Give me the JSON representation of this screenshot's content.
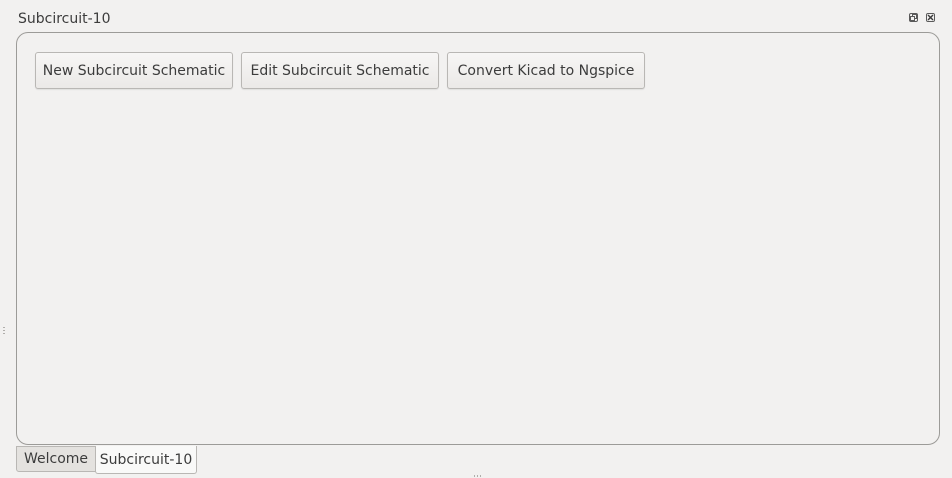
{
  "dock": {
    "title": "Subcircuit-10"
  },
  "toolbar": {
    "new_label": "New Subcircuit Schematic",
    "edit_label": "Edit Subcircuit Schematic",
    "convert_label": "Convert Kicad to Ngspice"
  },
  "tabs": [
    {
      "label": "Welcome",
      "active": false
    },
    {
      "label": "Subcircuit-10",
      "active": true
    }
  ],
  "icons": {
    "float": "restore-icon",
    "close": "close-icon"
  }
}
